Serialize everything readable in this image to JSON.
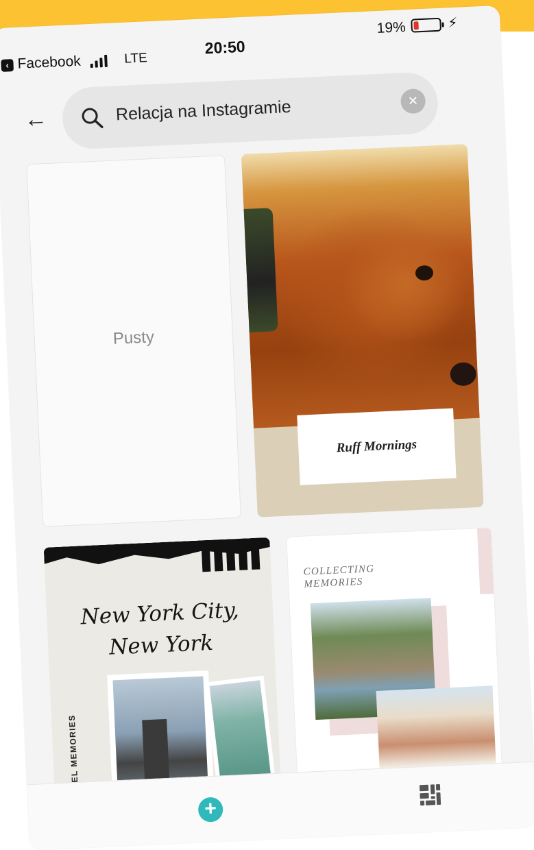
{
  "status_bar": {
    "back_app": "Facebook",
    "network": "LTE",
    "time": "20:50",
    "battery": "19%",
    "battery_level": 0.19
  },
  "search": {
    "query": "Relacja na Instagramie"
  },
  "templates": {
    "blank": {
      "label": "Pusty"
    },
    "dog": {
      "caption": "Ruff Mornings"
    },
    "ny": {
      "title_line1": "New York City,",
      "title_line2": "New York",
      "side_text": "MY TRAVEL MEMORIES"
    },
    "memories": {
      "line1": "COLLECTING",
      "line2": "MEMORIES"
    }
  },
  "colors": {
    "top_band": "#fcc232",
    "accent_teal": "#2fb9bb",
    "battery_red": "#e0342a"
  },
  "icons": {
    "back": "arrow-left-icon",
    "search": "magnifier-icon",
    "clear": "close-circle-icon",
    "add": "plus-circle-icon",
    "layout": "grid-layout-icon"
  }
}
